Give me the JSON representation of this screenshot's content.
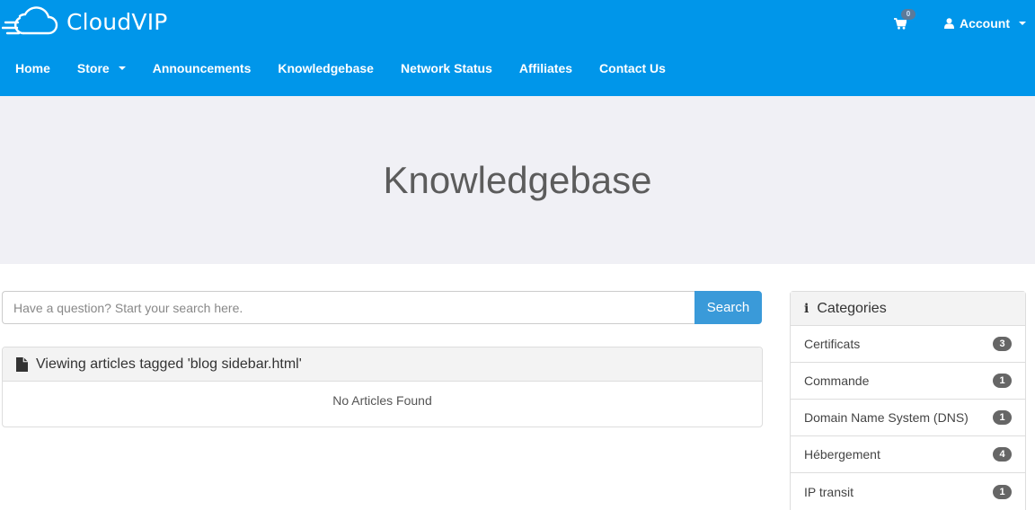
{
  "header": {
    "brand": "CloudVIP",
    "cart_count": "0",
    "account_label": "Account",
    "colors": {
      "bar": "#0096ea"
    }
  },
  "nav": {
    "items": [
      {
        "label": "Home"
      },
      {
        "label": "Store",
        "has_dropdown": true
      },
      {
        "label": "Announcements"
      },
      {
        "label": "Knowledgebase"
      },
      {
        "label": "Network Status"
      },
      {
        "label": "Affiliates"
      },
      {
        "label": "Contact Us"
      }
    ]
  },
  "hero": {
    "title": "Knowledgebase"
  },
  "search": {
    "placeholder": "Have a question? Start your search here.",
    "value": "",
    "button_label": "Search"
  },
  "articles_panel": {
    "title": "Viewing articles tagged 'blog sidebar.html'",
    "empty_message": "No Articles Found"
  },
  "categories": {
    "title": "Categories",
    "items": [
      {
        "label": "Certificats",
        "count": "3"
      },
      {
        "label": "Commande",
        "count": "1"
      },
      {
        "label": "Domain Name System (DNS)",
        "count": "1"
      },
      {
        "label": "Hébergement",
        "count": "4"
      },
      {
        "label": "IP transit",
        "count": "1"
      }
    ]
  }
}
